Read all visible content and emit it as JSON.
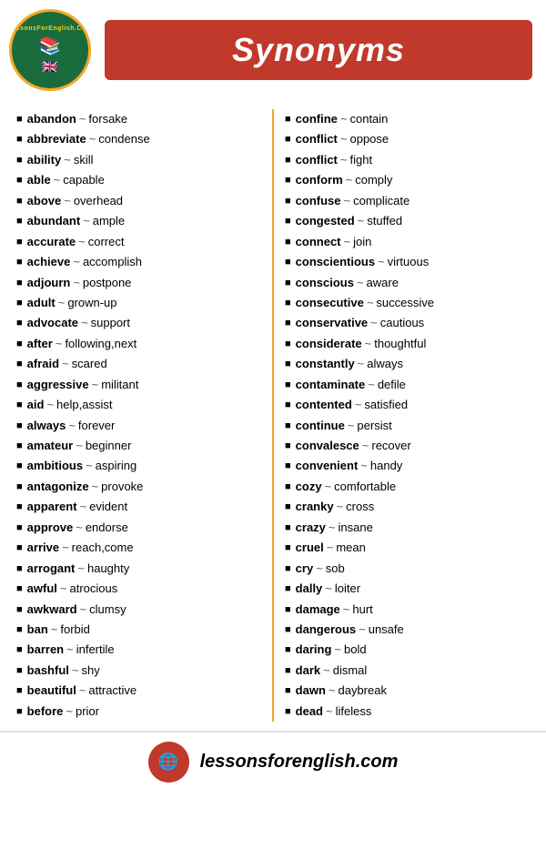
{
  "header": {
    "logo": {
      "text_top": "LessonsForEnglish.Com",
      "books_icon": "📚",
      "flag_icon": "🇬🇧"
    },
    "title": "Synonyms"
  },
  "left_column": [
    {
      "word": "abandon",
      "synonym": "forsake"
    },
    {
      "word": "abbreviate",
      "synonym": "condense"
    },
    {
      "word": "ability",
      "synonym": "skill"
    },
    {
      "word": "able",
      "synonym": "capable"
    },
    {
      "word": "above",
      "synonym": "overhead"
    },
    {
      "word": "abundant",
      "synonym": "ample"
    },
    {
      "word": "accurate",
      "synonym": "correct"
    },
    {
      "word": "achieve",
      "synonym": "accomplish"
    },
    {
      "word": "adjourn",
      "synonym": "postpone"
    },
    {
      "word": "adult",
      "synonym": "grown-up"
    },
    {
      "word": "advocate",
      "synonym": "support"
    },
    {
      "word": "after",
      "synonym": "following,next"
    },
    {
      "word": "afraid",
      "synonym": "scared"
    },
    {
      "word": "aggressive",
      "synonym": "militant"
    },
    {
      "word": "aid",
      "synonym": "help,assist"
    },
    {
      "word": "always",
      "synonym": "forever"
    },
    {
      "word": "amateur",
      "synonym": "beginner"
    },
    {
      "word": "ambitious",
      "synonym": "aspiring"
    },
    {
      "word": "antagonize",
      "synonym": "provoke"
    },
    {
      "word": "apparent",
      "synonym": "evident"
    },
    {
      "word": "approve",
      "synonym": "endorse"
    },
    {
      "word": "arrive",
      "synonym": "reach,come"
    },
    {
      "word": "arrogant",
      "synonym": "haughty"
    },
    {
      "word": "awful",
      "synonym": "atrocious"
    },
    {
      "word": "awkward",
      "synonym": "clumsy"
    },
    {
      "word": "ban",
      "synonym": "forbid"
    },
    {
      "word": "barren",
      "synonym": "infertile"
    },
    {
      "word": "bashful",
      "synonym": "shy"
    },
    {
      "word": "beautiful",
      "synonym": "attractive"
    },
    {
      "word": "before",
      "synonym": "prior"
    }
  ],
  "right_column": [
    {
      "word": "confine",
      "synonym": "contain"
    },
    {
      "word": "conflict",
      "synonym": "oppose"
    },
    {
      "word": "conflict",
      "synonym": "fight"
    },
    {
      "word": "conform",
      "synonym": "comply"
    },
    {
      "word": "confuse",
      "synonym": "complicate"
    },
    {
      "word": "congested",
      "synonym": "stuffed"
    },
    {
      "word": "connect",
      "synonym": "join"
    },
    {
      "word": "conscientious",
      "synonym": "virtuous"
    },
    {
      "word": "conscious",
      "synonym": "aware"
    },
    {
      "word": "consecutive",
      "synonym": "successive"
    },
    {
      "word": "conservative",
      "synonym": "cautious"
    },
    {
      "word": "considerate",
      "synonym": "thoughtful"
    },
    {
      "word": "constantly",
      "synonym": "always"
    },
    {
      "word": "contaminate",
      "synonym": "defile"
    },
    {
      "word": "contented",
      "synonym": "satisfied"
    },
    {
      "word": "continue",
      "synonym": "persist"
    },
    {
      "word": "convalesce",
      "synonym": "recover"
    },
    {
      "word": "convenient",
      "synonym": "handy"
    },
    {
      "word": "cozy",
      "synonym": "comfortable"
    },
    {
      "word": "cranky",
      "synonym": "cross"
    },
    {
      "word": "crazy",
      "synonym": "insane"
    },
    {
      "word": "cruel",
      "synonym": "mean"
    },
    {
      "word": "cry",
      "synonym": "sob"
    },
    {
      "word": "dally",
      "synonym": "loiter"
    },
    {
      "word": "damage",
      "synonym": "hurt"
    },
    {
      "word": "dangerous",
      "synonym": "unsafe"
    },
    {
      "word": "daring",
      "synonym": "bold"
    },
    {
      "word": "dark",
      "synonym": "dismal"
    },
    {
      "word": "dawn",
      "synonym": "daybreak"
    },
    {
      "word": "dead",
      "synonym": "lifeless"
    }
  ],
  "footer": {
    "url": "lessonsforenglish.com",
    "globe_icon": "🌐"
  }
}
